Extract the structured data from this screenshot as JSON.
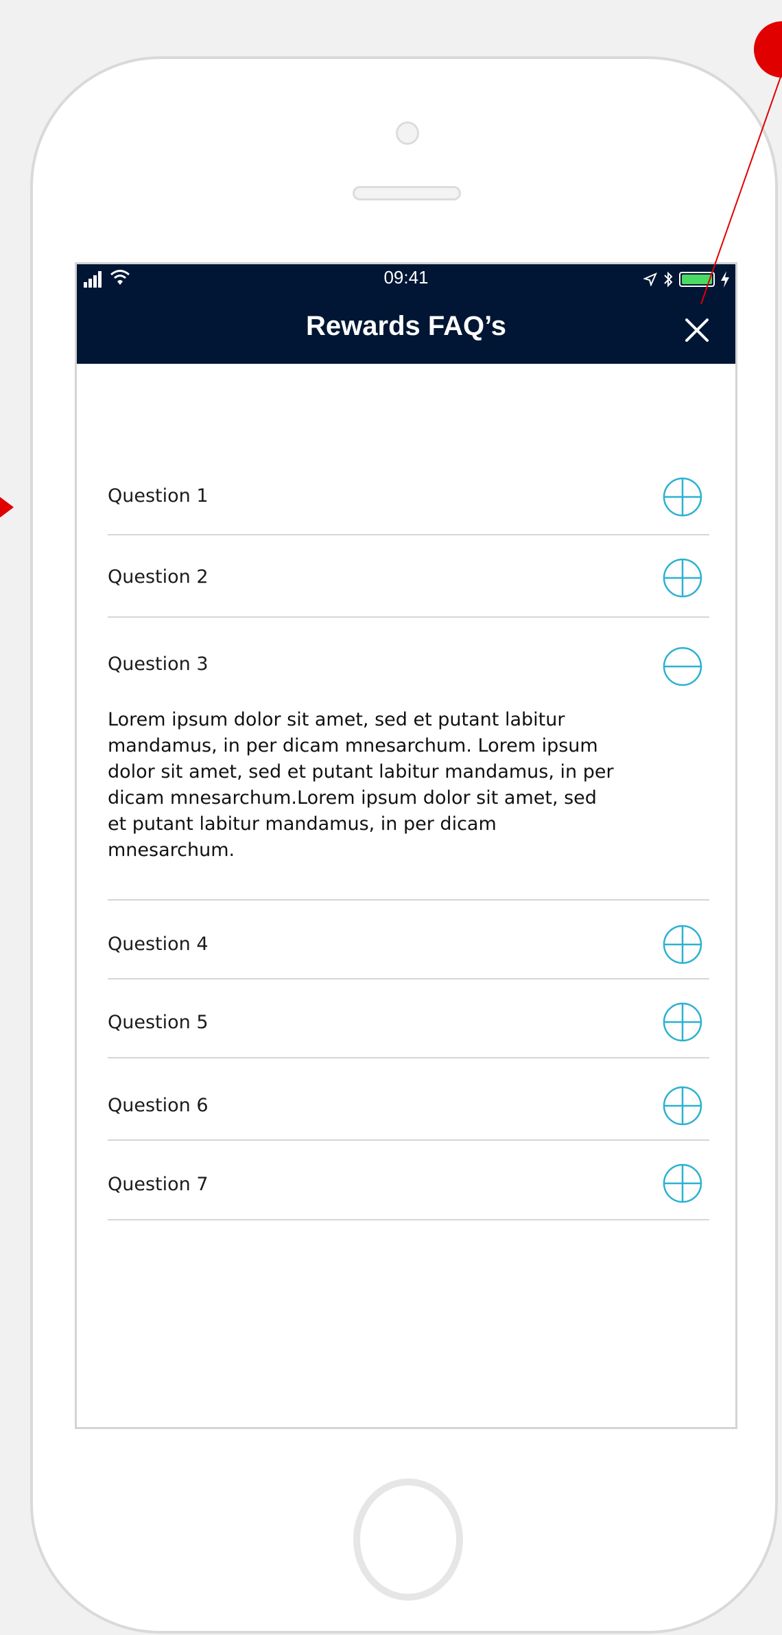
{
  "status_bar": {
    "time": "09:41",
    "battery_level_percent": 100
  },
  "header": {
    "title": "Rewards FAQ’s",
    "close_icon": "close-icon"
  },
  "faq": {
    "items": [
      {
        "question": "Question 1",
        "expanded": false,
        "icon": "plus-circle-icon"
      },
      {
        "question": "Question 2",
        "expanded": false,
        "icon": "plus-circle-icon"
      },
      {
        "question": "Question 3",
        "expanded": true,
        "icon": "minus-circle-icon",
        "answer": "Lorem ipsum dolor sit amet, sed et putant labitur mandamus, in per dicam mnesarchum. Lorem ipsum dolor sit amet, sed et putant labitur mandamus, in per dicam mnesarchum.Lorem ipsum dolor sit amet, sed et putant labitur mandamus, in per dicam mnesarchum."
      },
      {
        "question": "Question 4",
        "expanded": false,
        "icon": "plus-circle-icon"
      },
      {
        "question": "Question 5",
        "expanded": false,
        "icon": "plus-circle-icon"
      },
      {
        "question": "Question 6",
        "expanded": false,
        "icon": "plus-circle-icon"
      },
      {
        "question": "Question 7",
        "expanded": false,
        "icon": "plus-circle-icon"
      }
    ]
  },
  "colors": {
    "nav_background": "#001634",
    "accent": "#2bb1d1",
    "annotation": "#e00000",
    "divider": "#d6d6d6"
  }
}
